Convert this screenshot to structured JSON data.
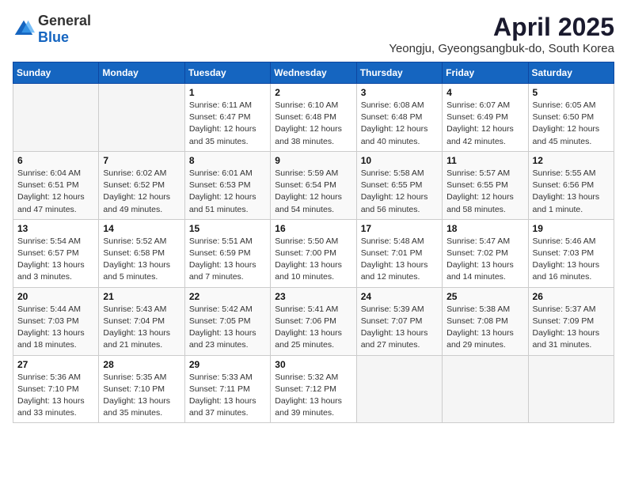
{
  "logo": {
    "general": "General",
    "blue": "Blue"
  },
  "header": {
    "month": "April 2025",
    "location": "Yeongju, Gyeongsangbuk-do, South Korea"
  },
  "days_of_week": [
    "Sunday",
    "Monday",
    "Tuesday",
    "Wednesday",
    "Thursday",
    "Friday",
    "Saturday"
  ],
  "weeks": [
    [
      {
        "day": "",
        "detail": ""
      },
      {
        "day": "",
        "detail": ""
      },
      {
        "day": "1",
        "detail": "Sunrise: 6:11 AM\nSunset: 6:47 PM\nDaylight: 12 hours and 35 minutes."
      },
      {
        "day": "2",
        "detail": "Sunrise: 6:10 AM\nSunset: 6:48 PM\nDaylight: 12 hours and 38 minutes."
      },
      {
        "day": "3",
        "detail": "Sunrise: 6:08 AM\nSunset: 6:48 PM\nDaylight: 12 hours and 40 minutes."
      },
      {
        "day": "4",
        "detail": "Sunrise: 6:07 AM\nSunset: 6:49 PM\nDaylight: 12 hours and 42 minutes."
      },
      {
        "day": "5",
        "detail": "Sunrise: 6:05 AM\nSunset: 6:50 PM\nDaylight: 12 hours and 45 minutes."
      }
    ],
    [
      {
        "day": "6",
        "detail": "Sunrise: 6:04 AM\nSunset: 6:51 PM\nDaylight: 12 hours and 47 minutes."
      },
      {
        "day": "7",
        "detail": "Sunrise: 6:02 AM\nSunset: 6:52 PM\nDaylight: 12 hours and 49 minutes."
      },
      {
        "day": "8",
        "detail": "Sunrise: 6:01 AM\nSunset: 6:53 PM\nDaylight: 12 hours and 51 minutes."
      },
      {
        "day": "9",
        "detail": "Sunrise: 5:59 AM\nSunset: 6:54 PM\nDaylight: 12 hours and 54 minutes."
      },
      {
        "day": "10",
        "detail": "Sunrise: 5:58 AM\nSunset: 6:55 PM\nDaylight: 12 hours and 56 minutes."
      },
      {
        "day": "11",
        "detail": "Sunrise: 5:57 AM\nSunset: 6:55 PM\nDaylight: 12 hours and 58 minutes."
      },
      {
        "day": "12",
        "detail": "Sunrise: 5:55 AM\nSunset: 6:56 PM\nDaylight: 13 hours and 1 minute."
      }
    ],
    [
      {
        "day": "13",
        "detail": "Sunrise: 5:54 AM\nSunset: 6:57 PM\nDaylight: 13 hours and 3 minutes."
      },
      {
        "day": "14",
        "detail": "Sunrise: 5:52 AM\nSunset: 6:58 PM\nDaylight: 13 hours and 5 minutes."
      },
      {
        "day": "15",
        "detail": "Sunrise: 5:51 AM\nSunset: 6:59 PM\nDaylight: 13 hours and 7 minutes."
      },
      {
        "day": "16",
        "detail": "Sunrise: 5:50 AM\nSunset: 7:00 PM\nDaylight: 13 hours and 10 minutes."
      },
      {
        "day": "17",
        "detail": "Sunrise: 5:48 AM\nSunset: 7:01 PM\nDaylight: 13 hours and 12 minutes."
      },
      {
        "day": "18",
        "detail": "Sunrise: 5:47 AM\nSunset: 7:02 PM\nDaylight: 13 hours and 14 minutes."
      },
      {
        "day": "19",
        "detail": "Sunrise: 5:46 AM\nSunset: 7:03 PM\nDaylight: 13 hours and 16 minutes."
      }
    ],
    [
      {
        "day": "20",
        "detail": "Sunrise: 5:44 AM\nSunset: 7:03 PM\nDaylight: 13 hours and 18 minutes."
      },
      {
        "day": "21",
        "detail": "Sunrise: 5:43 AM\nSunset: 7:04 PM\nDaylight: 13 hours and 21 minutes."
      },
      {
        "day": "22",
        "detail": "Sunrise: 5:42 AM\nSunset: 7:05 PM\nDaylight: 13 hours and 23 minutes."
      },
      {
        "day": "23",
        "detail": "Sunrise: 5:41 AM\nSunset: 7:06 PM\nDaylight: 13 hours and 25 minutes."
      },
      {
        "day": "24",
        "detail": "Sunrise: 5:39 AM\nSunset: 7:07 PM\nDaylight: 13 hours and 27 minutes."
      },
      {
        "day": "25",
        "detail": "Sunrise: 5:38 AM\nSunset: 7:08 PM\nDaylight: 13 hours and 29 minutes."
      },
      {
        "day": "26",
        "detail": "Sunrise: 5:37 AM\nSunset: 7:09 PM\nDaylight: 13 hours and 31 minutes."
      }
    ],
    [
      {
        "day": "27",
        "detail": "Sunrise: 5:36 AM\nSunset: 7:10 PM\nDaylight: 13 hours and 33 minutes."
      },
      {
        "day": "28",
        "detail": "Sunrise: 5:35 AM\nSunset: 7:10 PM\nDaylight: 13 hours and 35 minutes."
      },
      {
        "day": "29",
        "detail": "Sunrise: 5:33 AM\nSunset: 7:11 PM\nDaylight: 13 hours and 37 minutes."
      },
      {
        "day": "30",
        "detail": "Sunrise: 5:32 AM\nSunset: 7:12 PM\nDaylight: 13 hours and 39 minutes."
      },
      {
        "day": "",
        "detail": ""
      },
      {
        "day": "",
        "detail": ""
      },
      {
        "day": "",
        "detail": ""
      }
    ]
  ]
}
